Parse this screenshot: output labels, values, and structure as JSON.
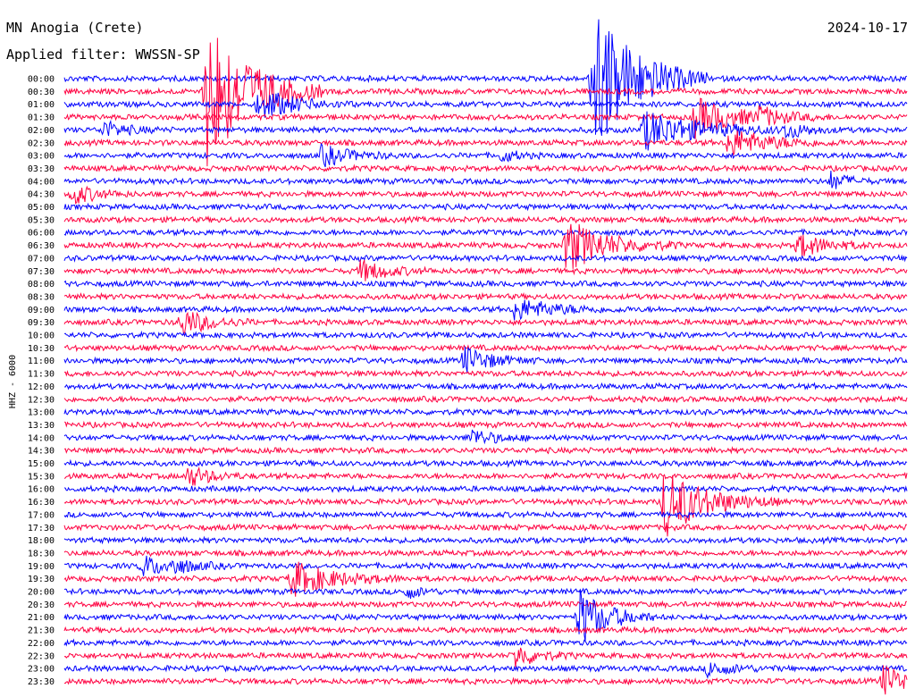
{
  "header": {
    "station": "MN Anogia (Crete)",
    "date": "2024-10-17",
    "filter": "Applied filter: WWSSN-SP"
  },
  "chart_data": {
    "type": "line",
    "title": "MN Anogia (Crete)",
    "subtitle": "Applied filter: WWSSN-SP",
    "ylabel": "HHZ - 6000",
    "colors": [
      "#0000ff",
      "#ff0040"
    ],
    "row_labels": [
      "00:00",
      "00:30",
      "01:00",
      "01:30",
      "02:00",
      "02:30",
      "03:00",
      "03:30",
      "04:00",
      "04:30",
      "05:00",
      "05:30",
      "06:00",
      "06:30",
      "07:00",
      "07:30",
      "08:00",
      "08:30",
      "09:00",
      "09:30",
      "10:00",
      "10:30",
      "11:00",
      "11:30",
      "12:00",
      "12:30",
      "13:00",
      "13:30",
      "14:00",
      "14:30",
      "15:00",
      "15:30",
      "16:00",
      "16:30",
      "17:00",
      "17:30",
      "18:00",
      "18:30",
      "19:00",
      "19:30",
      "20:00",
      "20:30",
      "21:00",
      "21:30",
      "22:00",
      "22:30",
      "23:00",
      "23:30"
    ],
    "events": [
      {
        "row": 1,
        "minute": 5.5,
        "amplitude": 95,
        "duration": 1.5
      },
      {
        "row": 0,
        "minute": 20.5,
        "amplitude": 95,
        "duration": 1.5
      },
      {
        "row": 2,
        "minute": 7.5,
        "amplitude": 12,
        "duration": 0.8
      },
      {
        "row": 2,
        "minute": 7.8,
        "amplitude": 16,
        "duration": 1.2
      },
      {
        "row": 3,
        "minute": 24.5,
        "amplitude": 22,
        "duration": 1.5
      },
      {
        "row": 3,
        "minute": 27.0,
        "amplitude": 12,
        "duration": 1.0
      },
      {
        "row": 4,
        "minute": 1.5,
        "amplitude": 10,
        "duration": 0.8
      },
      {
        "row": 4,
        "minute": 22.5,
        "amplitude": 22,
        "duration": 2.0
      },
      {
        "row": 4,
        "minute": 28.0,
        "amplitude": 10,
        "duration": 0.8
      },
      {
        "row": 5,
        "minute": 25.8,
        "amplitude": 16,
        "duration": 1.5
      },
      {
        "row": 6,
        "minute": 10.0,
        "amplitude": 12,
        "duration": 1.0
      },
      {
        "row": 6,
        "minute": 17.0,
        "amplitude": 8,
        "duration": 0.5
      },
      {
        "row": 9,
        "minute": 0.3,
        "amplitude": 12,
        "duration": 0.8
      },
      {
        "row": 8,
        "minute": 29.8,
        "amplitude": 10,
        "duration": 0.6
      },
      {
        "row": 13,
        "minute": 19.5,
        "amplitude": 30,
        "duration": 1.5
      },
      {
        "row": 13,
        "minute": 28.5,
        "amplitude": 14,
        "duration": 1.0
      },
      {
        "row": 15,
        "minute": 11.5,
        "amplitude": 12,
        "duration": 1.0
      },
      {
        "row": 18,
        "minute": 17.5,
        "amplitude": 12,
        "duration": 1.5
      },
      {
        "row": 19,
        "minute": 4.5,
        "amplitude": 16,
        "duration": 1.0
      },
      {
        "row": 22,
        "minute": 15.5,
        "amplitude": 16,
        "duration": 1.0
      },
      {
        "row": 28,
        "minute": 15.8,
        "amplitude": 10,
        "duration": 0.8
      },
      {
        "row": 31,
        "minute": 4.8,
        "amplitude": 12,
        "duration": 0.8
      },
      {
        "row": 33,
        "minute": 23.3,
        "amplitude": 40,
        "duration": 1.5
      },
      {
        "row": 38,
        "minute": 3.0,
        "amplitude": 12,
        "duration": 1.0
      },
      {
        "row": 38,
        "minute": 4.2,
        "amplitude": 10,
        "duration": 0.8
      },
      {
        "row": 39,
        "minute": 8.8,
        "amplitude": 20,
        "duration": 1.5
      },
      {
        "row": 40,
        "minute": 13.3,
        "amplitude": 8,
        "duration": 0.5
      },
      {
        "row": 42,
        "minute": 20.0,
        "amplitude": 35,
        "duration": 1.0
      },
      {
        "row": 45,
        "minute": 17.5,
        "amplitude": 14,
        "duration": 0.8
      },
      {
        "row": 46,
        "minute": 25.0,
        "amplitude": 8,
        "duration": 1.0
      },
      {
        "row": 47,
        "minute": 31.8,
        "amplitude": 18,
        "duration": 1.0
      }
    ]
  }
}
